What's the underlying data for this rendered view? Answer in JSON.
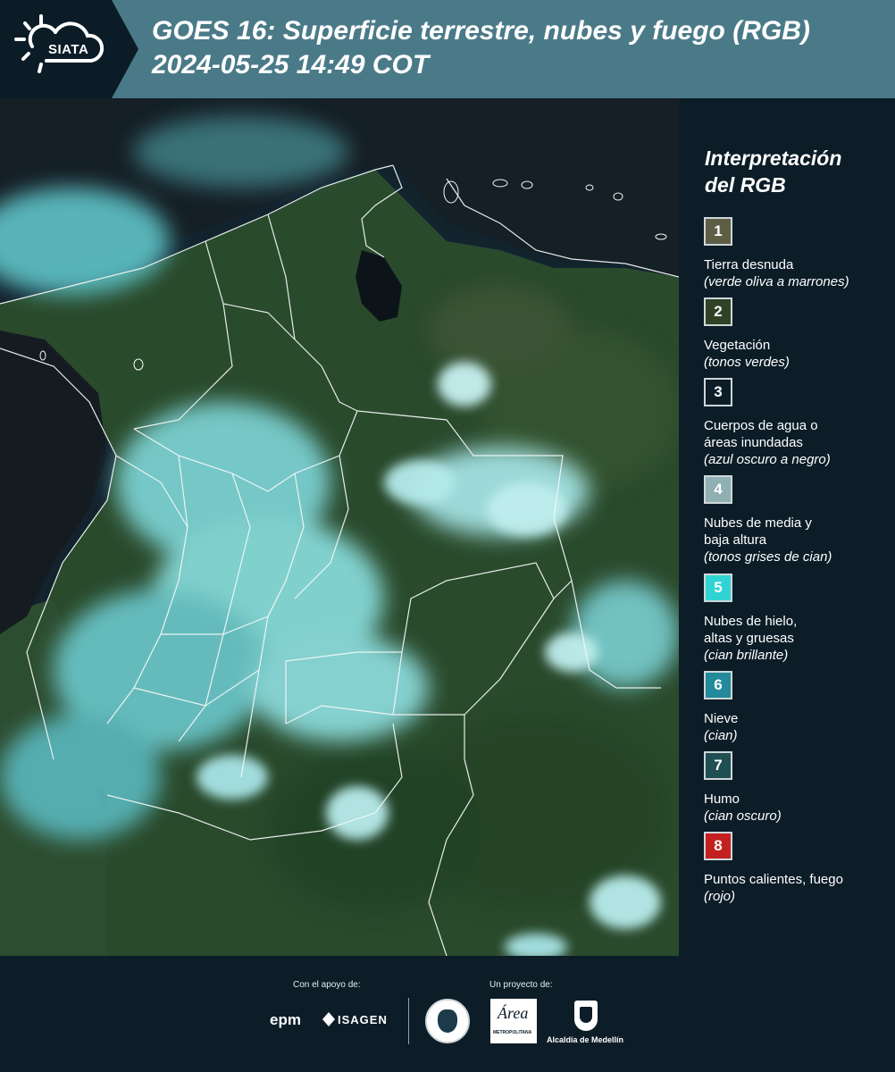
{
  "header": {
    "logo_text": "SIATA",
    "title_line1": "GOES 16: Superficie terrestre, nubes y fuego (RGB)",
    "title_line2": " 2024-05-25 14:49 COT"
  },
  "legend": {
    "title_line1": "Interpretación",
    "title_line2": "del RGB",
    "items": [
      {
        "number": "1",
        "label_lines": [
          "Tierra desnuda"
        ],
        "note": "(verde oliva a marrones)",
        "color": "#5e5e45"
      },
      {
        "number": "2",
        "label_lines": [
          "Vegetación"
        ],
        "note": "(tonos verdes)",
        "color": "#2f4225"
      },
      {
        "number": "3",
        "label_lines": [
          "Cuerpos de agua o",
          "áreas inundadas"
        ],
        "note": "(azul oscuro a negro)",
        "color": "#0c1d28"
      },
      {
        "number": "4",
        "label_lines": [
          "Nubes de media y",
          "baja altura"
        ],
        "note": "(tonos grises de cian)",
        "color": "#8fb0b2"
      },
      {
        "number": "5",
        "label_lines": [
          "Nubes de hielo,",
          "altas y gruesas"
        ],
        "note": "(cian brillante)",
        "color": "#2fd3d3"
      },
      {
        "number": "6",
        "label_lines": [
          "Nieve"
        ],
        "note": "(cian)",
        "color": "#238a9b"
      },
      {
        "number": "7",
        "label_lines": [
          "Humo"
        ],
        "note": "(cian oscuro)",
        "color": "#1f4f52"
      },
      {
        "number": "8",
        "label_lines": [
          "Puntos calientes, fuego"
        ],
        "note": "(rojo)",
        "color": "#c3201f"
      }
    ]
  },
  "footer": {
    "support_label": "Con el apoyo de:",
    "project_label": "Un proyecto de:",
    "epm_text": "epm",
    "isagen_text": "ISAGEN",
    "area_script": "Área",
    "area_sub": "METROPOLITANA",
    "alcaldia_text": "Alcaldía de Medellín"
  },
  "colors": {
    "header_bg": "#4a7a88",
    "panel_bg": "#0c1d28",
    "vegetation": "#2c4a2c",
    "ocean": "#13232e",
    "cloud": "#a9e8ea"
  }
}
